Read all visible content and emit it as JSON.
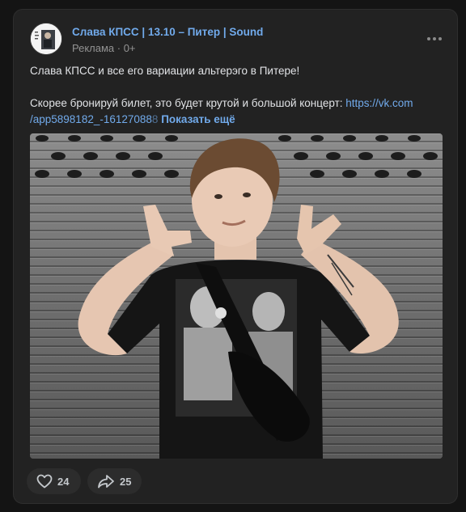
{
  "post": {
    "author": "Слава КПСС | 13.10 – Питер | Sound",
    "meta": "Реклама · 0+",
    "text_line1": "Слава КПСС и все его вариации альтерэго в Питере!",
    "text_line2_prefix": "Скорее бронируй билет, это будет крутой и большой концерт: ",
    "link_part1": "https://vk.com",
    "link_part2": "/app5898182_-16127088",
    "link_faded": "8",
    "show_more": "Показать ещё"
  },
  "actions": {
    "likes": "24",
    "shares": "25"
  },
  "colors": {
    "background": "#141414",
    "card": "#222222",
    "link": "#71aaeb",
    "text": "#e1e3e6",
    "muted": "#939393"
  },
  "icons": [
    "more-dots-icon",
    "heart-icon",
    "share-arrow-icon"
  ]
}
